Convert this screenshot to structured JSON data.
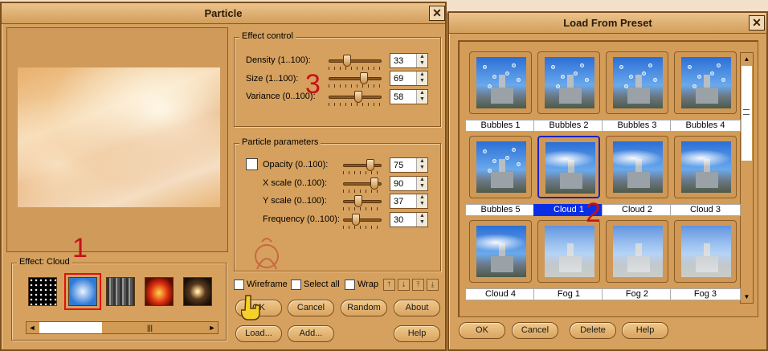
{
  "background": {
    "top_strip_color": "#f3e0c8"
  },
  "particle_window": {
    "title": "Particle",
    "close_label": "✕",
    "effect_group_label": "Effect: Cloud",
    "effect_control": {
      "legend": "Effect control",
      "sliders": [
        {
          "label": "Density (1..100):",
          "value": "33",
          "level": 0.33
        },
        {
          "label": "Size (1..100):",
          "value": "69",
          "level": 0.69
        },
        {
          "label": "Variance (0..100):",
          "value": "58",
          "level": 0.58
        }
      ]
    },
    "particle_parameters": {
      "legend": "Particle parameters",
      "sliders": [
        {
          "label": "Opacity (0..100):",
          "value": "75",
          "level": 0.75,
          "has_checkbox": true
        },
        {
          "label": "X scale (0..100):",
          "value": "90",
          "level": 0.9
        },
        {
          "label": "Y scale (0..100):",
          "value": "37",
          "level": 0.37
        },
        {
          "label": "Frequency (0..100):",
          "value": "30",
          "level": 0.3
        }
      ]
    },
    "options": {
      "wireframe": "Wireframe",
      "select_all": "Select all",
      "wrap": "Wrap"
    },
    "buttons": {
      "ok": "OK",
      "cancel": "Cancel",
      "random": "Random",
      "about": "About",
      "load": "Load...",
      "add": "Add...",
      "help": "Help"
    },
    "effects": [
      {
        "name": "stars-effect",
        "selected": false
      },
      {
        "name": "cloud-effect",
        "selected": true
      },
      {
        "name": "rain-effect",
        "selected": false
      },
      {
        "name": "fire-effect",
        "selected": false
      },
      {
        "name": "sparkle-effect",
        "selected": false
      }
    ],
    "scrollbar": {
      "grip": "|||",
      "left": "◄",
      "right": "►"
    }
  },
  "preset_window": {
    "title": "Load From Preset",
    "close_label": "✕",
    "presets": [
      {
        "label": "Bubbles 1",
        "kind": "bubbles"
      },
      {
        "label": "Bubbles 2",
        "kind": "bubbles"
      },
      {
        "label": "Bubbles 3",
        "kind": "bubbles"
      },
      {
        "label": "Bubbles 4",
        "kind": "bubbles"
      },
      {
        "label": "Bubbles 5",
        "kind": "bubbles"
      },
      {
        "label": "Cloud 1",
        "kind": "cloud",
        "selected": true
      },
      {
        "label": "Cloud 2",
        "kind": "cloud"
      },
      {
        "label": "Cloud 3",
        "kind": "cloud"
      },
      {
        "label": "Cloud 4",
        "kind": "cloud"
      },
      {
        "label": "Fog 1",
        "kind": "fog"
      },
      {
        "label": "Fog 2",
        "kind": "fog"
      },
      {
        "label": "Fog 3",
        "kind": "fog"
      }
    ],
    "buttons": {
      "ok": "OK",
      "cancel": "Cancel",
      "delete": "Delete",
      "help": "Help"
    },
    "scroll_up": "▲",
    "scroll_down": "▼"
  },
  "annotations": {
    "step1": "1",
    "step2": "2",
    "step3": "3"
  },
  "colors": {
    "window": "#d6a15e",
    "selection": "#0a2ee6",
    "annotation": "#c8101a"
  }
}
